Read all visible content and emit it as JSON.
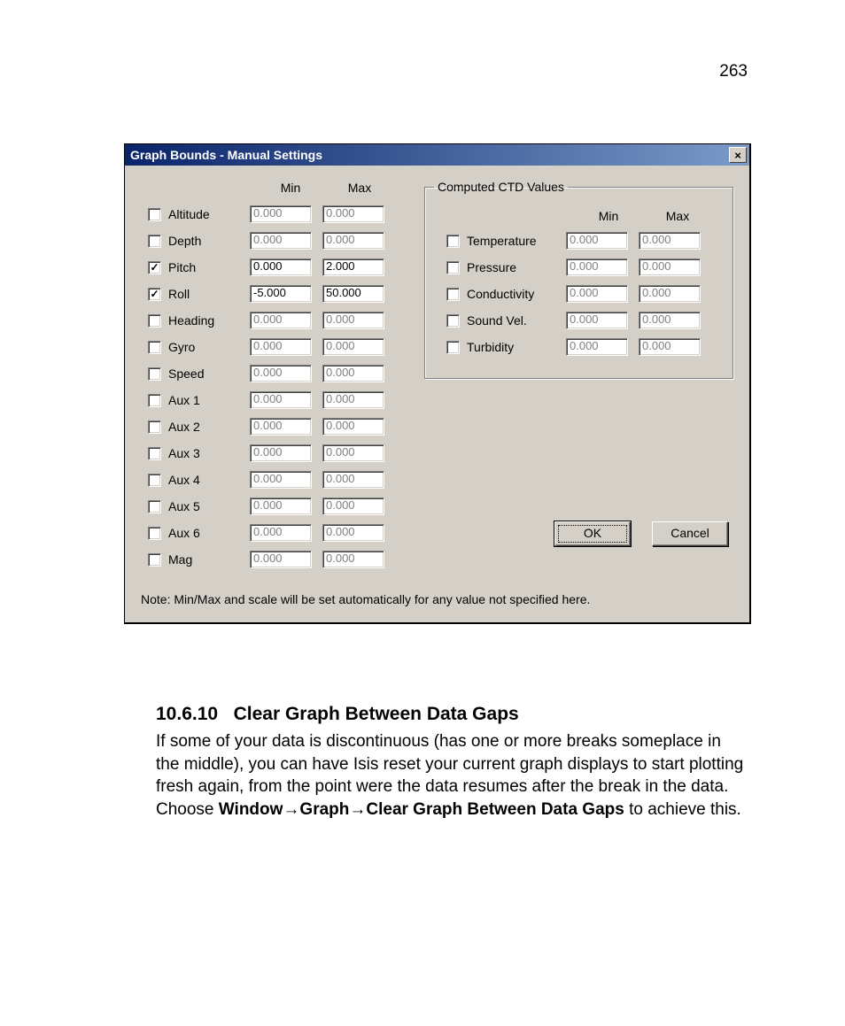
{
  "page_number": "263",
  "dialog": {
    "title": "Graph Bounds - Manual Settings",
    "close_glyph": "×",
    "min_label": "Min",
    "max_label": "Max",
    "params": [
      {
        "label": "Altitude",
        "checked": false,
        "min": "0.000",
        "max": "0.000",
        "enabled": false
      },
      {
        "label": "Depth",
        "checked": false,
        "min": "0.000",
        "max": "0.000",
        "enabled": false
      },
      {
        "label": "Pitch",
        "checked": true,
        "min": "0.000",
        "max": "2.000",
        "enabled": true
      },
      {
        "label": "Roll",
        "checked": true,
        "min": "-5.000",
        "max": "50.000",
        "enabled": true
      },
      {
        "label": "Heading",
        "checked": false,
        "min": "0.000",
        "max": "0.000",
        "enabled": false
      },
      {
        "label": "Gyro",
        "checked": false,
        "min": "0.000",
        "max": "0.000",
        "enabled": false
      },
      {
        "label": "Speed",
        "checked": false,
        "min": "0.000",
        "max": "0.000",
        "enabled": false
      },
      {
        "label": "Aux 1",
        "checked": false,
        "min": "0.000",
        "max": "0.000",
        "enabled": false
      },
      {
        "label": "Aux 2",
        "checked": false,
        "min": "0.000",
        "max": "0.000",
        "enabled": false
      },
      {
        "label": "Aux 3",
        "checked": false,
        "min": "0.000",
        "max": "0.000",
        "enabled": false
      },
      {
        "label": "Aux 4",
        "checked": false,
        "min": "0.000",
        "max": "0.000",
        "enabled": false
      },
      {
        "label": "Aux 5",
        "checked": false,
        "min": "0.000",
        "max": "0.000",
        "enabled": false
      },
      {
        "label": "Aux 6",
        "checked": false,
        "min": "0.000",
        "max": "0.000",
        "enabled": false
      },
      {
        "label": "Mag",
        "checked": false,
        "min": "0.000",
        "max": "0.000",
        "enabled": false
      }
    ],
    "ctd_title": "Computed CTD Values",
    "ctd_params": [
      {
        "label": "Temperature",
        "checked": false,
        "min": "0.000",
        "max": "0.000"
      },
      {
        "label": "Pressure",
        "checked": false,
        "min": "0.000",
        "max": "0.000"
      },
      {
        "label": "Conductivity",
        "checked": false,
        "min": "0.000",
        "max": "0.000"
      },
      {
        "label": "Sound Vel.",
        "checked": false,
        "min": "0.000",
        "max": "0.000"
      },
      {
        "label": "Turbidity",
        "checked": false,
        "min": "0.000",
        "max": "0.000"
      }
    ],
    "ok_label": "OK",
    "cancel_label": "Cancel",
    "note": "Note: Min/Max and scale will be set automatically for any value not specified here."
  },
  "section": {
    "number": "10.6.10",
    "title": "Clear Graph Between Data Gaps",
    "body_pre": "If some of your data is discontinuous (has one or more breaks someplace in the middle), you can have Isis reset your current graph displays to start plotting fresh again, from the point were the data resumes after the break in the data. Choose ",
    "menu_path": "Window→Graph→Clear Graph Between Data Gaps",
    "body_post": " to achieve this."
  }
}
